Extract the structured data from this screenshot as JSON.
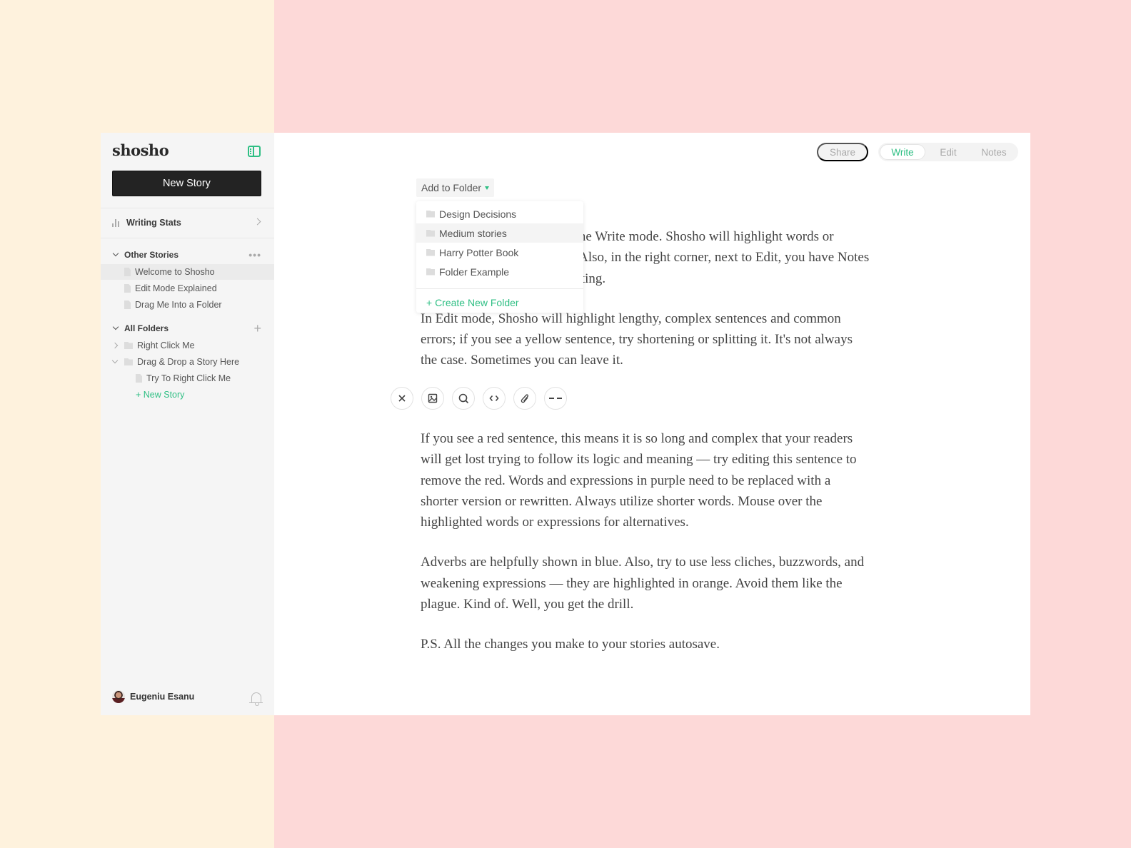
{
  "app": {
    "logo": "shosho",
    "accent_color": "#2fbf84"
  },
  "sidebar": {
    "new_story_label": "New Story",
    "writing_stats_label": "Writing Stats",
    "other_stories": {
      "title": "Other Stories",
      "items": [
        "Welcome to Shosho",
        "Edit Mode Explained",
        "Drag Me Into a Folder"
      ],
      "active_index": 0
    },
    "all_folders": {
      "title": "All Folders",
      "folders": [
        {
          "label": "Right Click Me",
          "expanded": false
        },
        {
          "label": "Drag & Drop a Story Here",
          "expanded": true,
          "stories": [
            "Try To Right Click Me"
          ],
          "new_story_label": "+ New Story"
        }
      ]
    },
    "user": {
      "name": "Eugeniu Esanu"
    }
  },
  "header": {
    "share_label": "Share",
    "modes": [
      "Write",
      "Edit",
      "Notes"
    ],
    "active_mode": "Write"
  },
  "folder_menu": {
    "button_label": "Add to Folder",
    "items": [
      "Design Decisions",
      "Medium stories",
      "Harry Potter Book",
      "Folder Example"
    ],
    "hovered_index": 1,
    "create_label": "+ Create New Folder"
  },
  "toolbar": {
    "tools": [
      "close-icon",
      "image-icon",
      "search-icon",
      "code-icon",
      "attachment-icon",
      "divider-icon"
    ]
  },
  "content": {
    "paragraphs_top": [
      "Welcome to Shosho. This is the Write mode. Shosho will highlight words or expressions while you write. Also, in the right corner, next to Edit, you have Notes to help you focus on your writing.",
      "In Edit mode, Shosho will highlight lengthy, complex sentences and common errors; if you see a yellow sentence, try shortening or splitting it. It's not always the case. Sometimes you can leave it."
    ],
    "paragraphs_bottom": [
      "If you see a red sentence, this means it is so long and complex that your readers will get lost trying to follow its logic and meaning — try editing this sentence to remove the red. Words and expressions in purple need to be replaced with a shorter version or rewritten. Always utilize shorter words. Mouse over the highlighted words or expressions for alternatives.",
      "Adverbs are helpfully shown in blue. Also, try to use less cliches, buzzwords, and weakening expressions — they are highlighted in orange. Avoid them like the plague. Kind of. Well, you get the drill.",
      "P.S. All the changes you make to your stories autosave."
    ]
  }
}
